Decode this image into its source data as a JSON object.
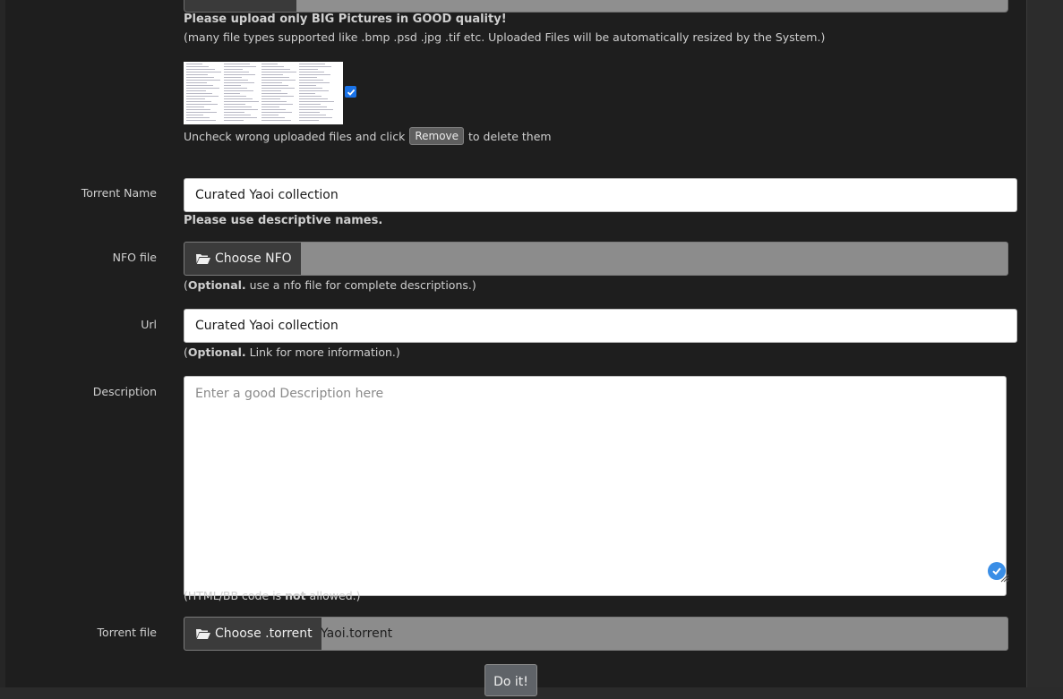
{
  "upload": {
    "instructions_bold": "Please upload only BIG Pictures in GOOD quality!",
    "instructions": "(many file types supported like .bmp .psd .jpg .tif etc. Uploaded Files will be automatically resized by the System.)",
    "thumbnail_checked": true,
    "uncheck_text": "Uncheck wrong uploaded files and click",
    "remove_label": "Remove",
    "delete_text": "to delete them"
  },
  "torrent_name": {
    "label": "Torrent Name",
    "value": "Curated Yaoi collection",
    "hint": "Please use descriptive names."
  },
  "nfo": {
    "label": "NFO file",
    "button": "Choose NFO",
    "icon": "folder-open-icon",
    "hint_bold": "Optional.",
    "hint": "use a nfo file for complete descriptions.)"
  },
  "url": {
    "label": "Url",
    "value": "Curated Yaoi collection",
    "hint_bold": "Optional.",
    "hint": "Link for more information.)"
  },
  "description": {
    "label": "Description",
    "placeholder": "Enter a good Description here",
    "hint_pre": "(HTML/BB code is",
    "hint_bold": "not",
    "hint_post": "allowed.)"
  },
  "torrent_file": {
    "label": "Torrent file",
    "button": "Choose .torrent",
    "icon": "folder-open-icon",
    "filename": "Yaoi.torrent"
  },
  "submit": {
    "label": "Do it!"
  },
  "colors": {
    "accent": "#1a73e8",
    "panel": "#1e1e1e",
    "button": "#3b3b3b"
  }
}
